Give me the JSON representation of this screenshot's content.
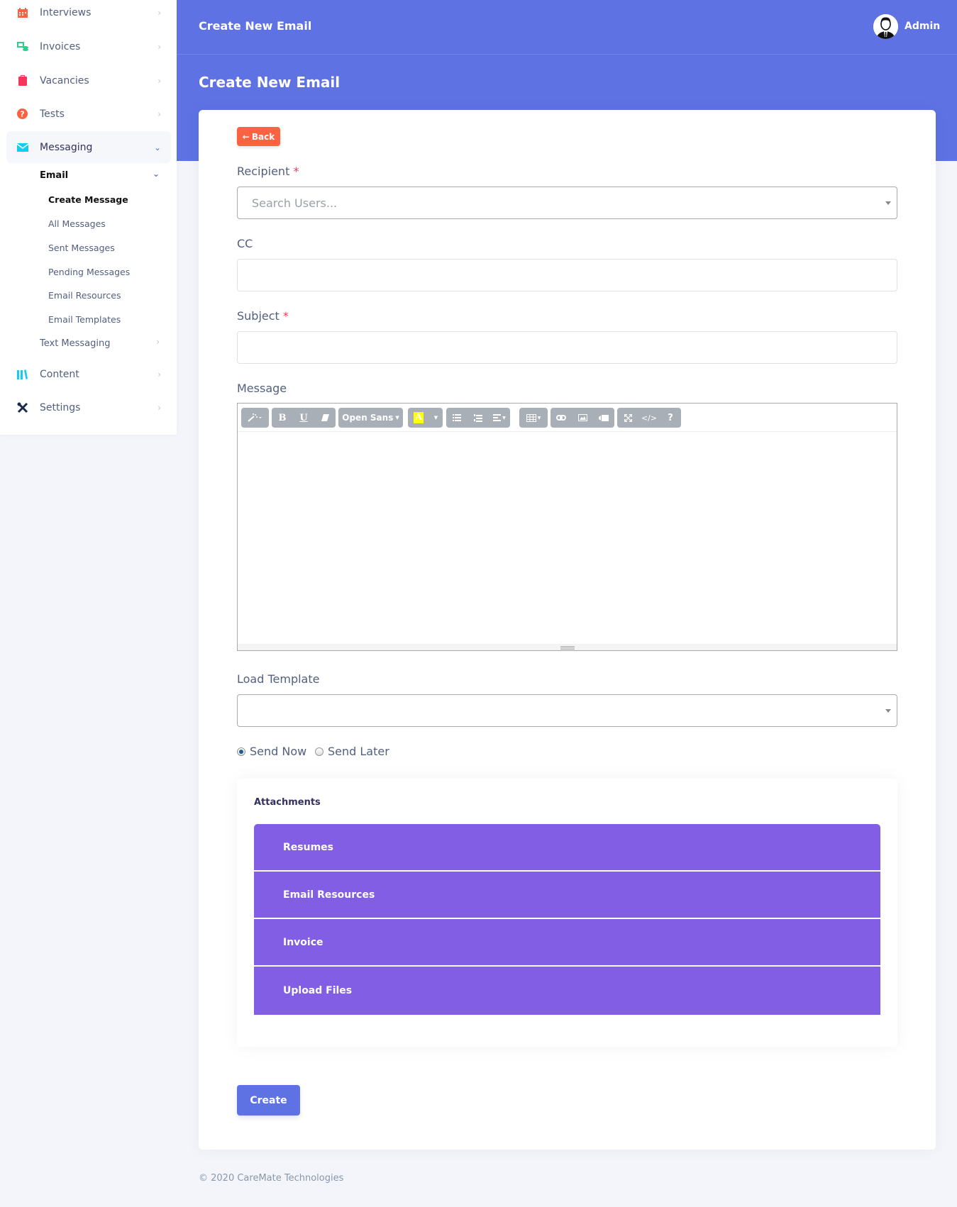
{
  "sidebar": {
    "items": [
      {
        "label": "Interviews",
        "icon": "calendar-icon",
        "color": "#fb6340"
      },
      {
        "label": "Invoices",
        "icon": "money-icon",
        "color": "#2dce89"
      },
      {
        "label": "Vacancies",
        "icon": "clipboard-icon",
        "color": "#f5365c"
      },
      {
        "label": "Tests",
        "icon": "question-icon",
        "color": "#fb6340"
      },
      {
        "label": "Messaging",
        "icon": "envelope-icon",
        "color": "#11cdef"
      },
      {
        "label": "Content",
        "icon": "books-icon",
        "color": "#11cdef"
      },
      {
        "label": "Settings",
        "icon": "tools-icon",
        "color": "#172b4d"
      }
    ],
    "messaging_sub": {
      "email_label": "Email",
      "email_items": [
        "Create Message",
        "All Messages",
        "Sent Messages",
        "Pending Messages",
        "Email Resources",
        "Email Templates"
      ],
      "text_messaging_label": "Text Messaging"
    }
  },
  "header": {
    "top_title": "Create New Email",
    "user_name": "Admin",
    "page_title": "Create New Email",
    "accent": "#5e72e4"
  },
  "form": {
    "back_label": "Back",
    "recipient_label": "Recipient",
    "recipient_placeholder": "Search Users...",
    "required_mark": "*",
    "cc_label": "CC",
    "cc_value": "",
    "subject_label": "Subject",
    "subject_value": "",
    "message_label": "Message",
    "toolbar": {
      "font_name": "Open Sans",
      "buttons": [
        "magic-style",
        "bold",
        "underline",
        "eraser",
        "font-name",
        "highlight-color",
        "color-dropdown",
        "unordered-list",
        "ordered-list",
        "paragraph-align",
        "table",
        "link",
        "picture",
        "video",
        "fullscreen",
        "code-view",
        "help"
      ]
    },
    "load_template_label": "Load Template",
    "load_template_value": "",
    "send_now_label": "Send Now",
    "send_later_label": "Send Later",
    "send_option": "now",
    "attachments_title": "Attachments",
    "attachments": [
      "Resumes",
      "Email Resources",
      "Invoice",
      "Upload Files"
    ],
    "create_label": "Create"
  },
  "footer": {
    "text": "© 2020 CareMate Technologies"
  }
}
